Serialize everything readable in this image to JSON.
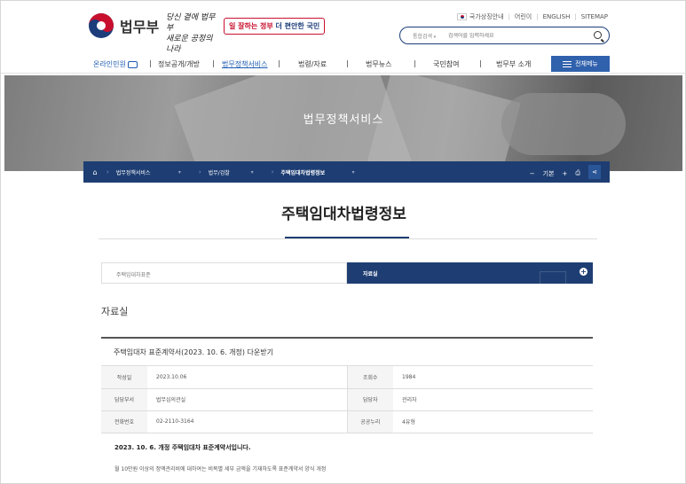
{
  "header": {
    "logo_text": "법무부",
    "slogan_line1": "당신 곁에 법무부",
    "slogan_line2": "새로운 공정의 나라",
    "campaign_red": "일 잘하는 정부",
    "campaign_blue": "더 편안한 국민",
    "util_links": [
      "국가상징안내",
      "어린이",
      "ENGLISH",
      "SITEMAP"
    ],
    "search_scope": "통합검색",
    "search_placeholder": "검색어를 입력하세요"
  },
  "nav": {
    "online": "온라인민원",
    "items": [
      "정보공개/개방",
      "법무정책서비스",
      "법령/자료",
      "법무뉴스",
      "국민참여",
      "법무부 소개"
    ],
    "all_menu": "전체메뉴"
  },
  "banner": {
    "title": "법무정책서비스"
  },
  "breadcrumb": {
    "level1": "법무정책서비스",
    "level2": "법무/검찰",
    "current": "주택임대차법령정보",
    "font_label": "기본"
  },
  "page": {
    "title": "주택임대차법령정보",
    "section_title": "자료실"
  },
  "tabs": [
    "주택임대차표준",
    "자료실"
  ],
  "board": {
    "subject": "주택임대차 표준계약서(2023. 10. 6. 개정) 다운받기",
    "rows": [
      {
        "k1": "작성일",
        "v1": "2023.10.06",
        "k2": "조회수",
        "v2": "1984"
      },
      {
        "k1": "담당부서",
        "v1": "법무심의관실",
        "k2": "담당자",
        "v2": "관리자"
      },
      {
        "k1": "전화번호",
        "v1": "02-2110-3164",
        "k2": "공공누리",
        "v2": "4유형"
      }
    ],
    "content_title": "2023. 10. 6. 개정 주택임대차 표준계약서입니다.",
    "content_body": "월 10만원 이상의 정액관리비에 대하여는 비목별 세부 금액을 기재하도록 표준계약서 양식 개정"
  },
  "colors": {
    "navy": "#1e3e73",
    "accent": "#3061ad",
    "red": "#c8102e"
  }
}
